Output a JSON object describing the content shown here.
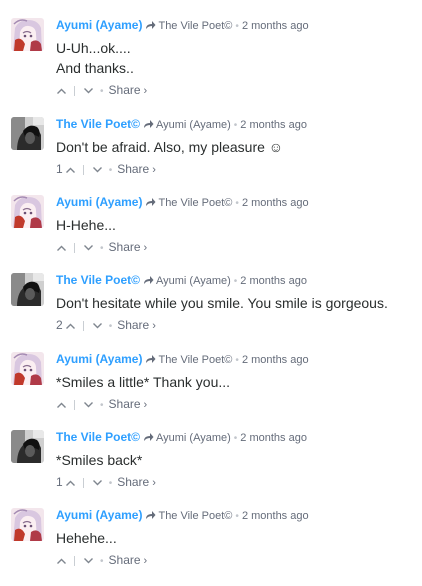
{
  "comments": [
    {
      "author": "Ayumi (Ayame)",
      "reply_to": "The Vile Poet©",
      "time": "2 months ago",
      "lines": [
        "U-Uh...ok....",
        "And thanks.."
      ],
      "votes": "",
      "share": "Share",
      "avatar": "anime-avatar"
    },
    {
      "author": "The Vile Poet©",
      "reply_to": "Ayumi (Ayame)",
      "time": "2 months ago",
      "lines": [
        "Don't be afraid. Also, my pleasure ☺"
      ],
      "votes": "1",
      "share": "Share",
      "avatar": "grayscale-avatar"
    },
    {
      "author": "Ayumi (Ayame)",
      "reply_to": "The Vile Poet©",
      "time": "2 months ago",
      "lines": [
        "H-Hehe..."
      ],
      "votes": "",
      "share": "Share",
      "avatar": "anime-avatar"
    },
    {
      "author": "The Vile Poet©",
      "reply_to": "Ayumi (Ayame)",
      "time": "2 months ago",
      "lines": [
        "Don't hesitate while you smile. You smile is gorgeous."
      ],
      "votes": "2",
      "share": "Share",
      "avatar": "grayscale-avatar"
    },
    {
      "author": "Ayumi (Ayame)",
      "reply_to": "The Vile Poet©",
      "time": "2 months ago",
      "lines": [
        "*Smiles a little* Thank you..."
      ],
      "votes": "",
      "share": "Share",
      "avatar": "anime-avatar"
    },
    {
      "author": "The Vile Poet©",
      "reply_to": "Ayumi (Ayame)",
      "time": "2 months ago",
      "lines": [
        "*Smiles back*"
      ],
      "votes": "1",
      "share": "Share",
      "avatar": "grayscale-avatar"
    },
    {
      "author": "Ayumi (Ayame)",
      "reply_to": "The Vile Poet©",
      "time": "2 months ago",
      "lines": [
        "Hehehe..."
      ],
      "votes": "",
      "share": "Share",
      "avatar": "anime-avatar"
    }
  ],
  "colors": {
    "author": "#2e9fff",
    "meta": "#656c7a",
    "text": "#2a2e2e"
  }
}
